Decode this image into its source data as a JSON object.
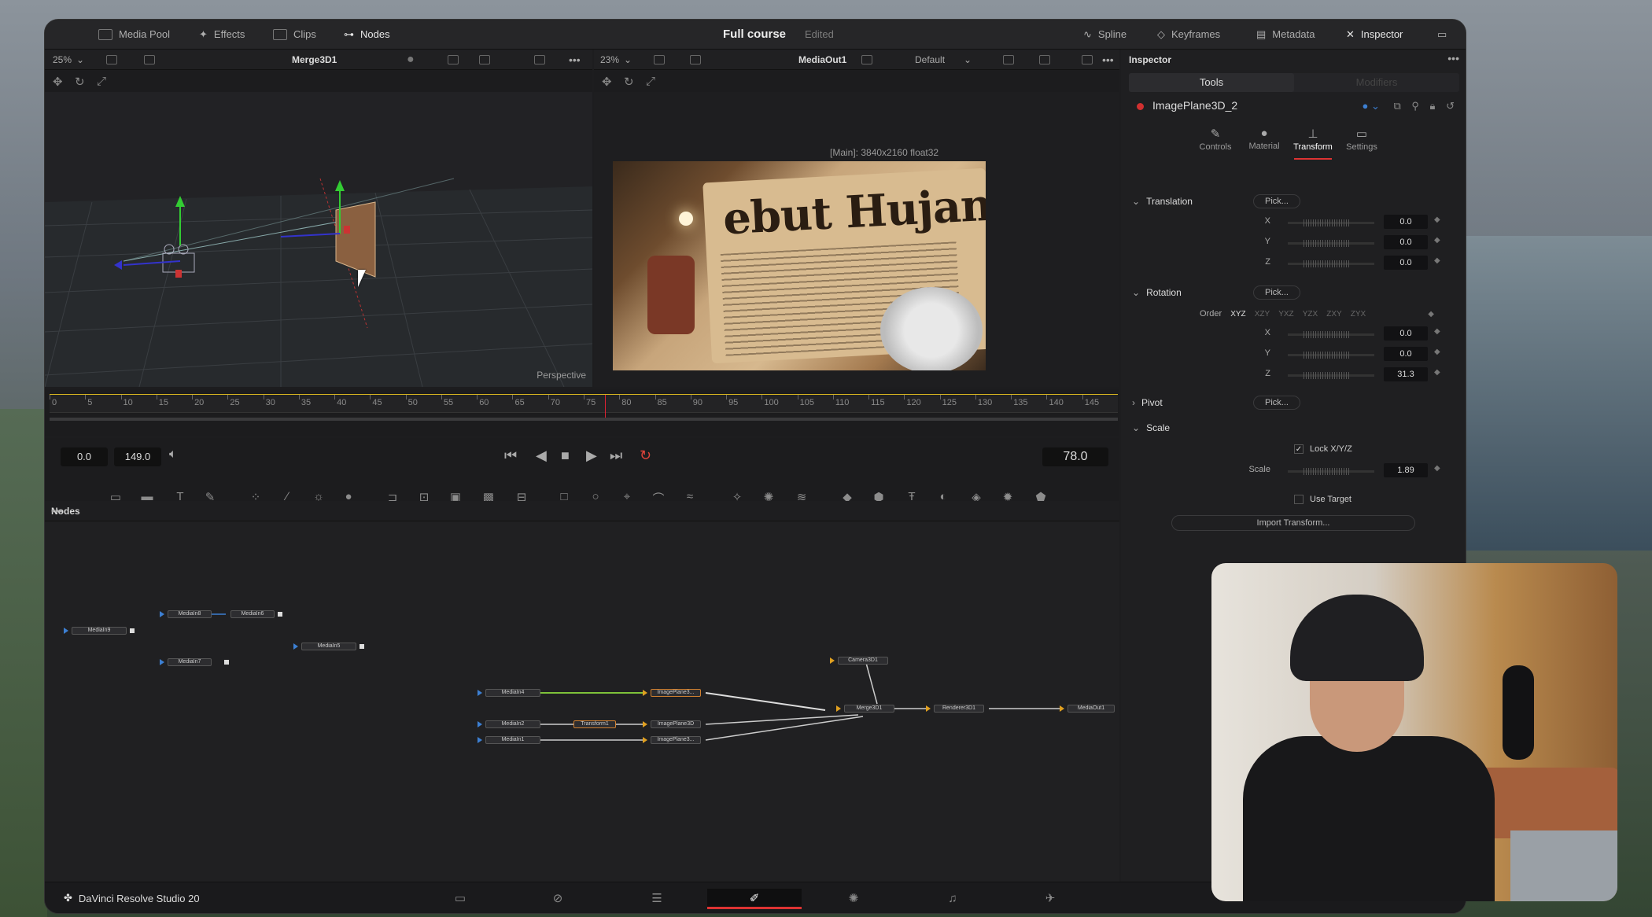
{
  "app": {
    "project_title": "Full course",
    "project_status": "Edited",
    "brand": "DaVinci Resolve Studio 20"
  },
  "topbar": {
    "left": [
      {
        "label": "Media Pool",
        "icon": "media-pool-icon"
      },
      {
        "label": "Effects",
        "icon": "effects-icon"
      },
      {
        "label": "Clips",
        "icon": "clips-icon"
      },
      {
        "label": "Nodes",
        "icon": "nodes-icon"
      }
    ],
    "right": [
      {
        "label": "Spline",
        "icon": "spline-icon"
      },
      {
        "label": "Keyframes",
        "icon": "keyframes-icon"
      },
      {
        "label": "Metadata",
        "icon": "metadata-icon"
      },
      {
        "label": "Inspector",
        "icon": "inspector-icon"
      }
    ]
  },
  "viewer_left": {
    "zoom": "25%",
    "node": "Merge3D1",
    "view_label": "Perspective"
  },
  "viewer_right": {
    "zoom": "23%",
    "node": "MediaOut1",
    "lut": "Default",
    "image_info": "[Main]: 3840x2160 float32",
    "headline": "ebut Hujan P"
  },
  "timeline": {
    "ticks": [
      "0",
      "5",
      "10",
      "15",
      "20",
      "25",
      "30",
      "35",
      "40",
      "45",
      "50",
      "55",
      "60",
      "65",
      "70",
      "75",
      "80",
      "85",
      "90",
      "95",
      "100",
      "105",
      "110",
      "115",
      "120",
      "125",
      "130",
      "135",
      "140",
      "145"
    ],
    "start": "0.0",
    "end": "149.0",
    "current": "78.0",
    "playhead_frame": 78
  },
  "nodes_panel": {
    "title": "Nodes",
    "nodes": [
      "MediaIn9",
      "MediaIn8",
      "MediaIn6",
      "MediaIn5",
      "MediaIn7",
      "MediaIn4",
      "MediaIn2",
      "MediaIn1",
      "Transform1",
      "ImagePlane3...",
      "ImagePlane3D",
      "ImagePlane3...",
      "Camera3D1",
      "Merge3D1",
      "Renderer3D1",
      "MediaOut1"
    ]
  },
  "inspector": {
    "title": "Inspector",
    "tabs": {
      "tools": "Tools",
      "modifiers": "Modifiers"
    },
    "object_name": "ImagePlane3D_2",
    "subtabs": [
      "Controls",
      "Material",
      "Transform",
      "Settings"
    ],
    "translation": {
      "label": "Translation",
      "pick": "Pick...",
      "x": "0.0",
      "y": "0.0",
      "z": "0.0"
    },
    "rotation": {
      "label": "Rotation",
      "pick": "Pick...",
      "order_label": "Order",
      "orders": [
        "XYZ",
        "XZY",
        "YXZ",
        "YZX",
        "ZXY",
        "ZYX"
      ],
      "x": "0.0",
      "y": "0.0",
      "z": "31.3"
    },
    "pivot": {
      "label": "Pivot",
      "pick": "Pick..."
    },
    "scale": {
      "label": "Scale",
      "lock": "Lock X/Y/Z",
      "scale_label": "Scale",
      "value": "1.89",
      "use_target": "Use Target",
      "import": "Import Transform..."
    },
    "axis_labels": {
      "x": "X",
      "y": "Y",
      "z": "Z"
    }
  },
  "colors": {
    "accent_red": "#d33333",
    "playhead": "#dd2233",
    "timeline_range": "#d6b420"
  }
}
